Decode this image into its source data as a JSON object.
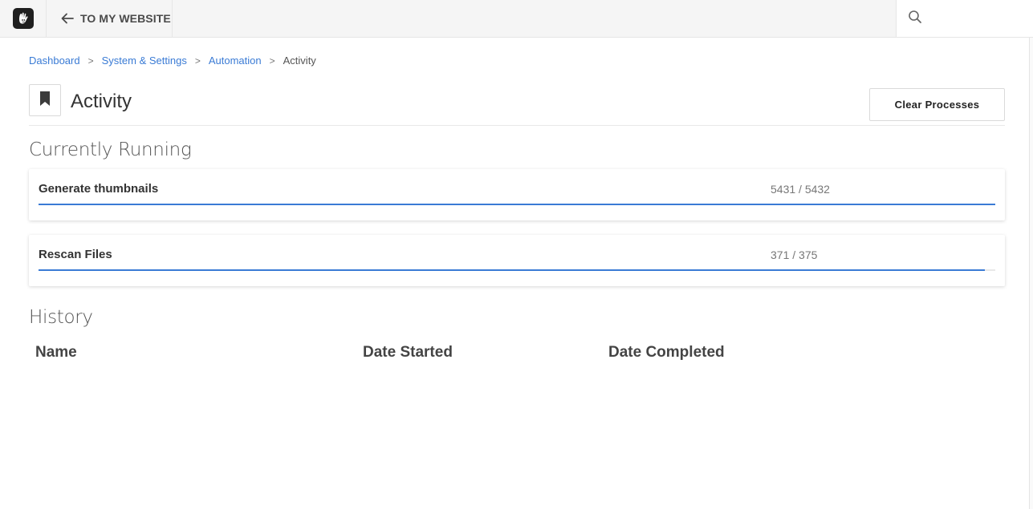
{
  "topbar": {
    "back_label": "TO MY WEBSITE"
  },
  "breadcrumb": {
    "items": [
      "Dashboard",
      "System & Settings",
      "Automation"
    ],
    "separator": ">",
    "current": "Activity"
  },
  "header": {
    "title": "Activity",
    "clear_button": "Clear Processes"
  },
  "running": {
    "title": "Currently Running",
    "processes": [
      {
        "name": "Generate thumbnails",
        "count": "5431 / 5432",
        "progress": 0.9998
      },
      {
        "name": "Rescan Files",
        "count": "371 / 375",
        "progress": 0.9893
      }
    ]
  },
  "history": {
    "title": "History",
    "columns": [
      "Name",
      "Date Started",
      "Date Completed"
    ]
  },
  "icons": {
    "logo": "concrete-hand-logo-icon",
    "back": "arrow-left-icon",
    "search": "search-icon",
    "page": "bookmark-icon"
  },
  "colors": {
    "accent": "#3a7bd5",
    "topbar": "#f5f5f5"
  }
}
